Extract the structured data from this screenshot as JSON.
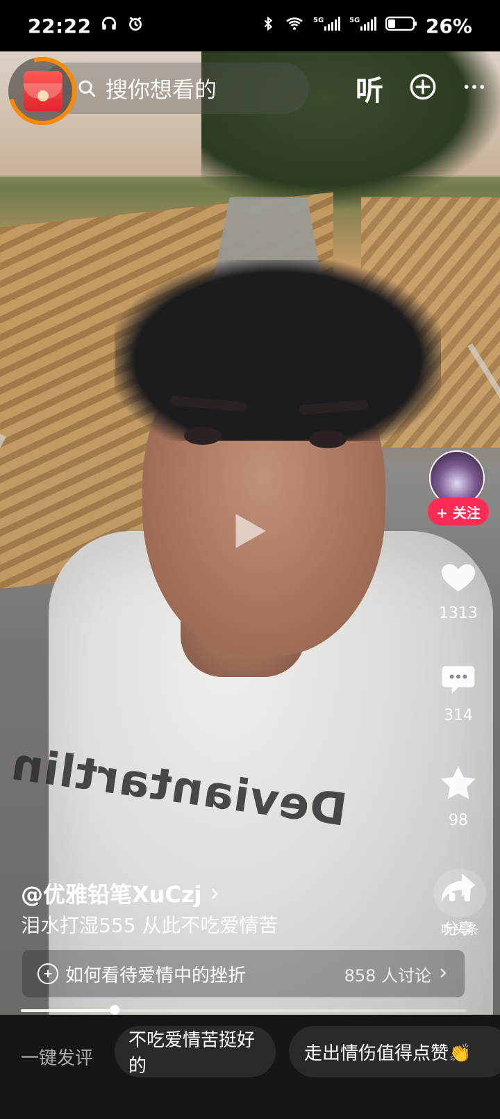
{
  "status_bar": {
    "time": "22:22",
    "battery_percent": "26%"
  },
  "top_bar": {
    "search_placeholder": "搜你想看的",
    "listen_label": "听"
  },
  "actions": {
    "follow_label": "+ 关注",
    "like_count": "1313",
    "comment_count": "314",
    "favorite_count": "98",
    "share_label": "分享",
    "listen_headline_label": "听头条"
  },
  "post": {
    "author": "@优雅铅笔XuCzj",
    "caption": "泪水打湿555 从此不吃爱情苦"
  },
  "topic": {
    "title": "如何看待爱情中的挫折",
    "discussion": "858 人讨论"
  },
  "progress": {
    "fraction": 0.21
  },
  "quick_comments": {
    "label": "一键发评",
    "chips": [
      "不吃爱情苦挺好的",
      "走出情伤值得点赞👏"
    ]
  },
  "shirt": {
    "print": "Deviantartlin"
  },
  "colors": {
    "follow_red": "#ff2d55",
    "ring_orange": "#ff8a00"
  }
}
